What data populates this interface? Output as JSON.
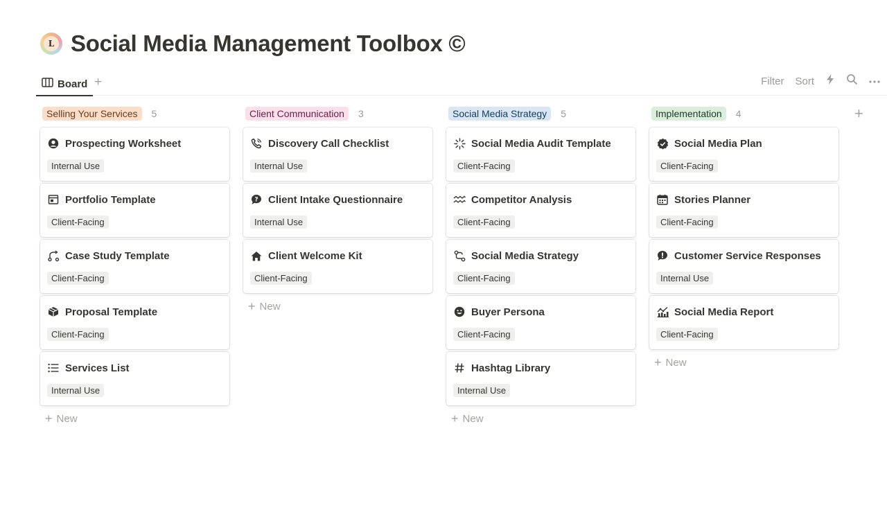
{
  "page": {
    "title": "Social Media Management Toolbox ©",
    "logo_letter": "L"
  },
  "viewbar": {
    "tab_label": "Board",
    "add_view": "+",
    "filter_label": "Filter",
    "sort_label": "Sort",
    "icons": [
      "board-icon",
      "lightning-icon",
      "search-icon",
      "more-icon"
    ]
  },
  "board": {
    "add_group": "+",
    "new_label": "New",
    "new_plus": "+",
    "columns": [
      {
        "name": "Selling Your Services",
        "count": "5",
        "tag_bg": "#fadec9",
        "tag_fg": "#6a3b1c",
        "cards": [
          {
            "title": "Prospecting Worksheet",
            "tag": "Internal Use",
            "icon": "user-circle-icon"
          },
          {
            "title": "Portfolio Template",
            "tag": "Client-Facing",
            "icon": "browser-window-icon"
          },
          {
            "title": "Case Study Template",
            "tag": "Client-Facing",
            "icon": "flow-icon"
          },
          {
            "title": "Proposal Template",
            "tag": "Client-Facing",
            "icon": "box-icon"
          },
          {
            "title": "Services List",
            "tag": "Internal Use",
            "icon": "list-icon"
          }
        ]
      },
      {
        "name": "Client Communication",
        "count": "3",
        "tag_bg": "#f9e0ea",
        "tag_fg": "#6c2048",
        "cards": [
          {
            "title": "Discovery Call Checklist",
            "tag": "Internal Use",
            "icon": "phone-icon"
          },
          {
            "title": "Client Intake Questionnaire",
            "tag": "Internal Use",
            "icon": "question-bubble-icon"
          },
          {
            "title": "Client Welcome Kit",
            "tag": "Client-Facing",
            "icon": "home-icon"
          }
        ]
      },
      {
        "name": "Social Media Strategy",
        "count": "5",
        "tag_bg": "#d8e7f3",
        "tag_fg": "#183a5a",
        "cards": [
          {
            "title": "Social Media Audit Template",
            "tag": "Client-Facing",
            "icon": "loading-icon"
          },
          {
            "title": "Competitor Analysis",
            "tag": "Client-Facing",
            "icon": "waves-icon"
          },
          {
            "title": "Social Media Strategy",
            "tag": "Client-Facing",
            "icon": "route-icon"
          },
          {
            "title": "Buyer Persona",
            "tag": "Client-Facing",
            "icon": "smiley-icon"
          },
          {
            "title": "Hashtag Library",
            "tag": "Internal Use",
            "icon": "hashtag-icon"
          }
        ]
      },
      {
        "name": "Implementation",
        "count": "4",
        "tag_bg": "#dbeddb",
        "tag_fg": "#1c3829",
        "cards": [
          {
            "title": "Social Media Plan",
            "tag": "Client-Facing",
            "icon": "verified-badge-icon"
          },
          {
            "title": "Stories Planner",
            "tag": "Client-Facing",
            "icon": "calendar-icon"
          },
          {
            "title": "Customer Service Responses",
            "tag": "Internal Use",
            "icon": "alert-bubble-icon"
          },
          {
            "title": "Social Media Report",
            "tag": "Client-Facing",
            "icon": "chart-icon"
          }
        ]
      }
    ]
  }
}
